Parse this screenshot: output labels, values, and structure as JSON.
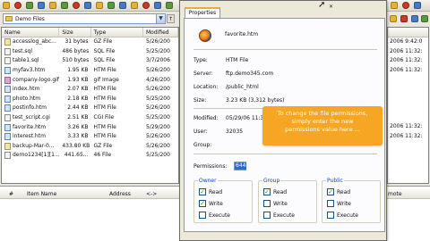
{
  "folder": {
    "current": "Demo Files"
  },
  "filelist": {
    "columns": {
      "name": "Name",
      "size": "Size",
      "type": "Type",
      "modified": "Modified"
    },
    "rows": [
      {
        "name": "accesslog_abc...",
        "size": "31 bytes",
        "type": "GZ File",
        "modified": "5/26/200",
        "icon": "gz"
      },
      {
        "name": "test.sql",
        "size": "486 bytes",
        "type": "SQL File",
        "modified": "5/25/200",
        "icon": "cgi"
      },
      {
        "name": "table1.sql",
        "size": "510 bytes",
        "type": "SQL File",
        "modified": "3/7/2006",
        "icon": "cgi"
      },
      {
        "name": "myfav3.htm",
        "size": "1.95 KB",
        "type": "HTM File",
        "modified": "5/26/200",
        "icon": "htm"
      },
      {
        "name": "company-logo.gif",
        "size": "1.93 KB",
        "type": "gif Image",
        "modified": "4/26/200",
        "icon": "img"
      },
      {
        "name": "index.htm",
        "size": "2.07 KB",
        "type": "HTM File",
        "modified": "5/26/200",
        "icon": "htm"
      },
      {
        "name": "photo.htm",
        "size": "2.18 KB",
        "type": "HTM File",
        "modified": "5/25/200",
        "icon": "htm"
      },
      {
        "name": "postinfo.htm",
        "size": "2.44 KB",
        "type": "HTM File",
        "modified": "5/26/200",
        "icon": "htm"
      },
      {
        "name": "test_script.cgi",
        "size": "2.51 KB",
        "type": "CGI File",
        "modified": "5/25/200",
        "icon": "cgi"
      },
      {
        "name": "favorite.htm",
        "size": "3.26 KB",
        "type": "HTM File",
        "modified": "5/29/200",
        "icon": "htm"
      },
      {
        "name": "interest.htm",
        "size": "3.33 KB",
        "type": "HTM File",
        "modified": "5/26/200",
        "icon": "htm"
      },
      {
        "name": "backup-Mar-0...",
        "size": "433.80 KB",
        "type": "GZ File",
        "modified": "5/26/200",
        "icon": "gz"
      },
      {
        "name": "demo1234[1][1...",
        "size": "441.65...",
        "type": "46 File",
        "modified": "5/25/200",
        "icon": "cgi"
      }
    ]
  },
  "rightlist": {
    "rows": [
      "2006 9:42:0",
      "2006 11:32:",
      "2006 11:32:",
      "2006 11:32:",
      "",
      "",
      "",
      "",
      "",
      "2006 11:32:",
      "2006 11:32:",
      "",
      ""
    ]
  },
  "queue": {
    "columns": {
      "hash": "#",
      "item": "Item Name",
      "address": "Address",
      "arrows": "<->",
      "remote": "mote"
    }
  },
  "dialog": {
    "tab": "Properties",
    "filename": "favorite.htm",
    "fields": {
      "type_label": "Type:",
      "type_value": "HTM File",
      "server_label": "Server:",
      "server_value": "ftp.demo345.com",
      "location_label": "Location:",
      "location_value": "/public_html",
      "size_label": "Size:",
      "size_value": "3.23 KB (3,312 bytes)",
      "modified_label": "Modified:",
      "modified_value": "05/29/06 11:32",
      "user_label": "User:",
      "user_value": "32035",
      "group_label": "Group:",
      "group_value": ""
    },
    "permissions_label": "Permissions:",
    "permissions_value": "644",
    "groups": {
      "owner": {
        "title": "Owner",
        "read": "Read",
        "write": "Write",
        "execute": "Execute"
      },
      "group": {
        "title": "Group",
        "read": "Read",
        "write": "Write",
        "execute": "Execute"
      },
      "public": {
        "title": "Public",
        "read": "Read",
        "write": "Write",
        "execute": "Execute"
      }
    }
  },
  "callout": {
    "line1": "To change the file permissions,",
    "line2": "simply enter the new",
    "line3": "permissions value here ..."
  },
  "colors": {
    "accent": "#f6a623",
    "selection": "#316ac5",
    "groupTitle": "#0046d5"
  }
}
